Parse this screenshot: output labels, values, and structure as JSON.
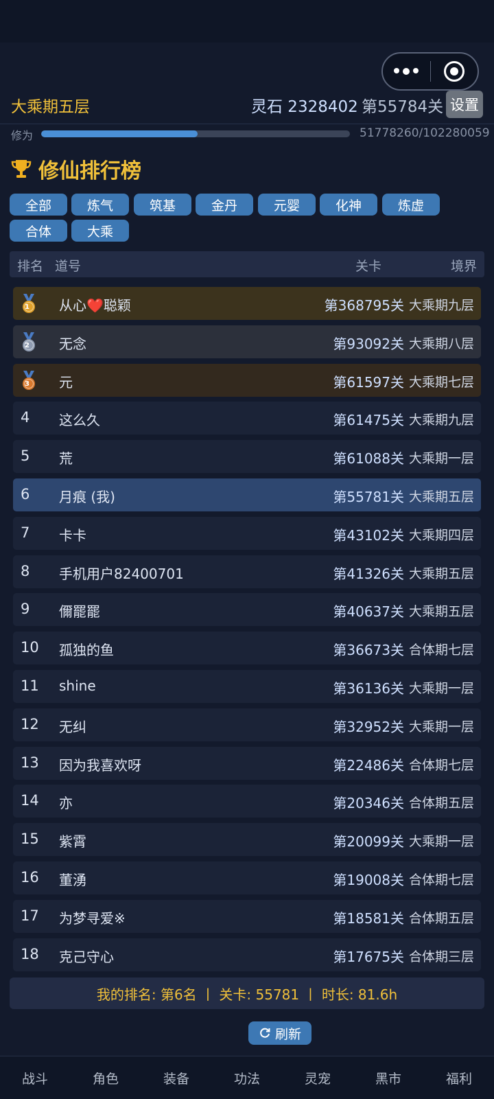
{
  "header": {
    "realm": "大乘期五层",
    "spirit_stones": "灵石 2328402",
    "current_stage": "第55784关",
    "settings_label": "设置"
  },
  "cultivation": {
    "label": "修为",
    "progress_text": "51778260/102280059",
    "fraction": 0.506
  },
  "leaderboard": {
    "title": "修仙排行榜",
    "filters": [
      "全部",
      "炼气",
      "筑基",
      "金丹",
      "元婴",
      "化神",
      "炼虚",
      "合体",
      "大乘"
    ],
    "columns": {
      "rank": "排名",
      "name": "道号",
      "stage": "关卡",
      "realm": "境界"
    },
    "rows": [
      {
        "rank": "1",
        "name": "从心❤️聪颖",
        "stage": "第368795关",
        "realm": "大乘期九层"
      },
      {
        "rank": "2",
        "name": "无念",
        "stage": "第93092关",
        "realm": "大乘期八层"
      },
      {
        "rank": "3",
        "name": "元",
        "stage": "第61597关",
        "realm": "大乘期七层"
      },
      {
        "rank": "4",
        "name": "这么久",
        "stage": "第61475关",
        "realm": "大乘期九层"
      },
      {
        "rank": "5",
        "name": "荒",
        "stage": "第61088关",
        "realm": "大乘期一层"
      },
      {
        "rank": "6",
        "name": "月痕 (我)",
        "stage": "第55781关",
        "realm": "大乘期五层"
      },
      {
        "rank": "7",
        "name": "卡卡",
        "stage": "第43102关",
        "realm": "大乘期四层"
      },
      {
        "rank": "8",
        "name": "手机用户82400701",
        "stage": "第41326关",
        "realm": "大乘期五层"
      },
      {
        "rank": "9",
        "name": "儞罷罷",
        "stage": "第40637关",
        "realm": "大乘期五层"
      },
      {
        "rank": "10",
        "name": "孤独的鱼",
        "stage": "第36673关",
        "realm": "合体期七层"
      },
      {
        "rank": "11",
        "name": "shine",
        "stage": "第36136关",
        "realm": "大乘期一层"
      },
      {
        "rank": "12",
        "name": "无纠",
        "stage": "第32952关",
        "realm": "大乘期一层"
      },
      {
        "rank": "13",
        "name": "因为我喜欢呀",
        "stage": "第22486关",
        "realm": "合体期七层"
      },
      {
        "rank": "14",
        "name": "亦",
        "stage": "第20346关",
        "realm": "合体期五层"
      },
      {
        "rank": "15",
        "name": "紫霄",
        "stage": "第20099关",
        "realm": "大乘期一层"
      },
      {
        "rank": "16",
        "name": "董湧",
        "stage": "第19008关",
        "realm": "合体期七层"
      },
      {
        "rank": "17",
        "name": "为梦寻爱※",
        "stage": "第18581关",
        "realm": "合体期五层"
      },
      {
        "rank": "18",
        "name": "克己守心",
        "stage": "第17675关",
        "realm": "合体期三层"
      }
    ]
  },
  "my_rank_text": "我的排名: 第6名 丨 关卡: 55781 丨 时长: 81.6h",
  "refresh_label": "刷新",
  "bottom_nav": [
    "战斗",
    "角色",
    "装备",
    "功法",
    "灵宠",
    "黑市",
    "福利"
  ]
}
